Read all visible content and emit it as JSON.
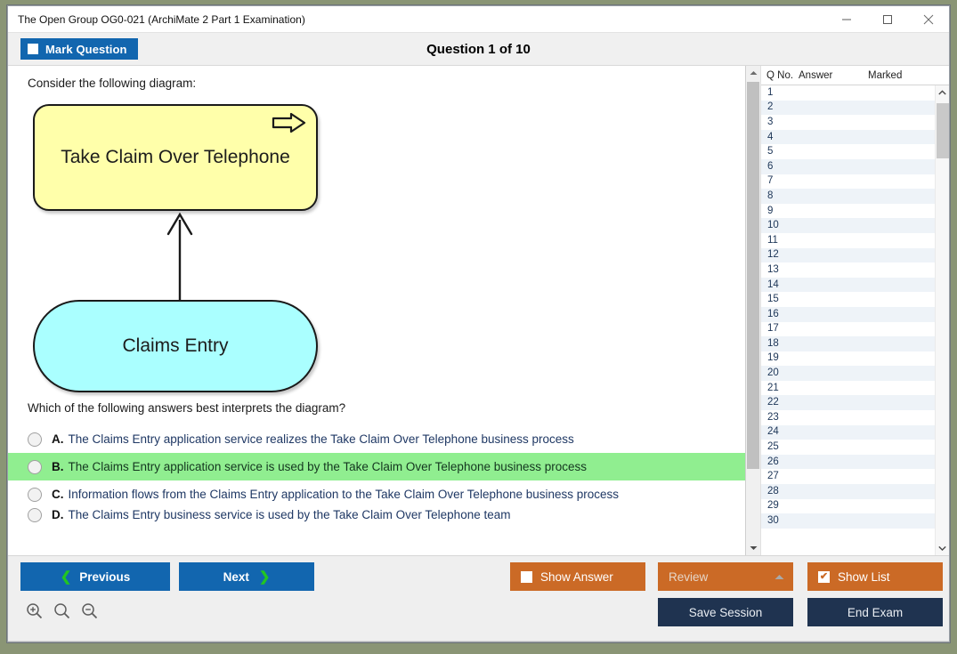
{
  "window": {
    "title": "The Open Group OG0-021 (ArchiMate 2 Part 1 Examination)",
    "minimize_icon": "minimize-icon",
    "maximize_icon": "maximize-icon",
    "close_icon": "close-icon"
  },
  "header": {
    "mark_question_label": "Mark Question",
    "question_title": "Question 1 of 10"
  },
  "content": {
    "prompt": "Consider the following diagram:",
    "question": "Which of the following answers best interprets the diagram?",
    "diagram": {
      "process_label": "Take Claim Over Telephone",
      "process_fill": "#ffffaa",
      "process_icon": "business-process-arrow-icon",
      "service_label": "Claims Entry",
      "service_fill": "#aaffff",
      "relationship": "used-by-arrow"
    },
    "options": [
      {
        "letter": "A.",
        "text": "The Claims Entry application service realizes the Take Claim Over Telephone business process",
        "highlighted": false
      },
      {
        "letter": "B.",
        "text": "The Claims Entry application service is used by the Take Claim Over Telephone business process",
        "highlighted": true
      },
      {
        "letter": "C.",
        "text": "Information flows from the Claims Entry application to the Take Claim Over Telephone business process",
        "highlighted": false
      },
      {
        "letter": "D.",
        "text": "The Claims Entry business service is used by the Take Claim Over Telephone team",
        "highlighted": false
      }
    ],
    "highlight_color": "#90ee90"
  },
  "list": {
    "columns": [
      "Q No.",
      "Answer",
      "Marked"
    ],
    "rows": [
      {
        "q": "1",
        "answer": "",
        "marked": ""
      },
      {
        "q": "2",
        "answer": "",
        "marked": ""
      },
      {
        "q": "3",
        "answer": "",
        "marked": ""
      },
      {
        "q": "4",
        "answer": "",
        "marked": ""
      },
      {
        "q": "5",
        "answer": "",
        "marked": ""
      },
      {
        "q": "6",
        "answer": "",
        "marked": ""
      },
      {
        "q": "7",
        "answer": "",
        "marked": ""
      },
      {
        "q": "8",
        "answer": "",
        "marked": ""
      },
      {
        "q": "9",
        "answer": "",
        "marked": ""
      },
      {
        "q": "10",
        "answer": "",
        "marked": ""
      },
      {
        "q": "11",
        "answer": "",
        "marked": ""
      },
      {
        "q": "12",
        "answer": "",
        "marked": ""
      },
      {
        "q": "13",
        "answer": "",
        "marked": ""
      },
      {
        "q": "14",
        "answer": "",
        "marked": ""
      },
      {
        "q": "15",
        "answer": "",
        "marked": ""
      },
      {
        "q": "16",
        "answer": "",
        "marked": ""
      },
      {
        "q": "17",
        "answer": "",
        "marked": ""
      },
      {
        "q": "18",
        "answer": "",
        "marked": ""
      },
      {
        "q": "19",
        "answer": "",
        "marked": ""
      },
      {
        "q": "20",
        "answer": "",
        "marked": ""
      },
      {
        "q": "21",
        "answer": "",
        "marked": ""
      },
      {
        "q": "22",
        "answer": "",
        "marked": ""
      },
      {
        "q": "23",
        "answer": "",
        "marked": ""
      },
      {
        "q": "24",
        "answer": "",
        "marked": ""
      },
      {
        "q": "25",
        "answer": "",
        "marked": ""
      },
      {
        "q": "26",
        "answer": "",
        "marked": ""
      },
      {
        "q": "27",
        "answer": "",
        "marked": ""
      },
      {
        "q": "28",
        "answer": "",
        "marked": ""
      },
      {
        "q": "29",
        "answer": "",
        "marked": ""
      },
      {
        "q": "30",
        "answer": "",
        "marked": ""
      }
    ]
  },
  "footer": {
    "previous_label": "Previous",
    "next_label": "Next",
    "show_answer_label": "Show Answer",
    "show_answer_checked": false,
    "review_label": "Review",
    "show_list_label": "Show List",
    "show_list_checked": true,
    "show_list_check_glyph": "✔",
    "save_session_label": "Save Session",
    "end_exam_label": "End Exam",
    "zoom_in_icon": "zoom-in-icon",
    "zoom_reset_icon": "zoom-reset-icon",
    "zoom_out_icon": "zoom-out-icon"
  },
  "colors": {
    "blue": "#1266af",
    "orange": "#cb6a26",
    "navy": "#1f3350",
    "green_chevron": "#22c522"
  }
}
